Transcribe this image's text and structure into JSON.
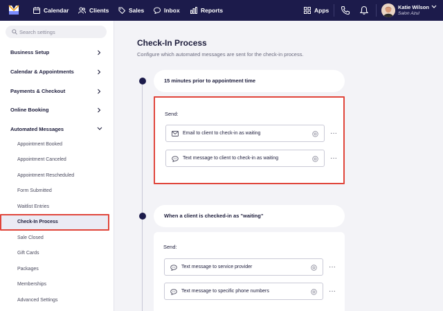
{
  "topbar": {
    "nav": [
      {
        "label": "Calendar",
        "icon": "calendar-icon"
      },
      {
        "label": "Clients",
        "icon": "clients-icon"
      },
      {
        "label": "Sales",
        "icon": "tag-icon"
      },
      {
        "label": "Inbox",
        "icon": "chat-icon"
      },
      {
        "label": "Reports",
        "icon": "reports-icon"
      }
    ],
    "apps_label": "Apps",
    "user": {
      "name": "Katie Wilson",
      "business": "Salon Azul"
    }
  },
  "sidebar": {
    "search_placeholder": "Search settings",
    "sections": [
      {
        "label": "Business Setup",
        "expanded": false
      },
      {
        "label": "Calendar & Appointments",
        "expanded": false
      },
      {
        "label": "Payments & Checkout",
        "expanded": false
      },
      {
        "label": "Online Booking",
        "expanded": false
      },
      {
        "label": "Automated Messages",
        "expanded": true
      }
    ],
    "sub_items": [
      "Appointment Booked",
      "Appointment Canceled",
      "Appointment Rescheduled",
      "Form Submitted",
      "Waitlist Entries",
      "Check-In Process",
      "Sale Closed",
      "Gift Cards",
      "Packages",
      "Memberships",
      "Advanced Settings"
    ],
    "active_item": "Check-In Process"
  },
  "main": {
    "title": "Check-In Process",
    "description": "Configure which automated messages are sent for the check-in process.",
    "steps": [
      {
        "trigger": "15 minutes prior to appointment time",
        "send_label": "Send:",
        "messages": [
          {
            "icon": "email-icon",
            "label": "Email to client to check-in as waiting"
          },
          {
            "icon": "sms-icon",
            "label": "Text message to client to check-in as waiting"
          }
        ]
      },
      {
        "trigger": "When a client is checked-in as \"waiting\"",
        "send_label": "Send:",
        "messages": [
          {
            "icon": "sms-icon",
            "label": "Text message to service provider"
          },
          {
            "icon": "sms-icon",
            "label": "Text message to specific phone numbers"
          }
        ]
      }
    ]
  },
  "colors": {
    "nav_bg": "#1c1b4b",
    "highlight": "#e0443a",
    "content_bg": "#f3f3f7"
  }
}
